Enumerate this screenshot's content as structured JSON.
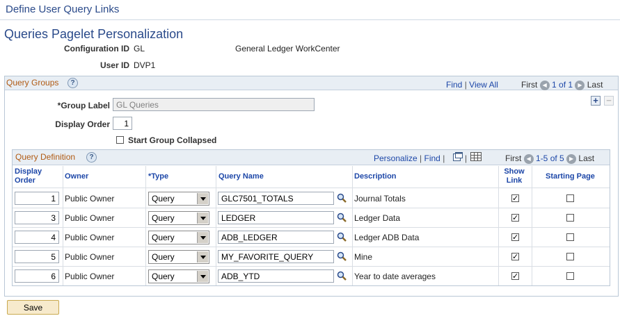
{
  "header": {
    "title": "Define User Query Links"
  },
  "page": {
    "title": "Queries Pagelet Personalization"
  },
  "config": {
    "config_id_label": "Configuration ID",
    "config_id_value": "GL",
    "config_desc": "General Ledger WorkCenter",
    "user_id_label": "User ID",
    "user_id_value": "DVP1"
  },
  "query_groups": {
    "title": "Query Groups",
    "find": "Find",
    "view_all": "View All",
    "first": "First",
    "pager": "1 of 1",
    "last": "Last",
    "group_label_label": "*Group Label",
    "group_label_value": "GL Queries",
    "display_order_label": "Display Order",
    "display_order_value": "1",
    "start_collapsed_label": "Start Group Collapsed",
    "start_collapsed_checked": false
  },
  "query_definition": {
    "title": "Query Definition",
    "personalize": "Personalize",
    "find": "Find",
    "first": "First",
    "pager": "1-5 of 5",
    "last": "Last",
    "columns": {
      "display_order_1": "Display",
      "display_order_2": "Order",
      "owner": "Owner",
      "type": "*Type",
      "query_name": "Query Name",
      "description": "Description",
      "show_link_1": "Show",
      "show_link_2": "Link",
      "starting_page": "Starting Page"
    },
    "rows": [
      {
        "order": "1",
        "owner": "Public Owner",
        "type": "Query",
        "query_name": "GLC7501_TOTALS",
        "description": "Journal Totals",
        "show_link": true,
        "starting_page": false
      },
      {
        "order": "3",
        "owner": "Public Owner",
        "type": "Query",
        "query_name": "LEDGER",
        "description": "Ledger Data",
        "show_link": true,
        "starting_page": false
      },
      {
        "order": "4",
        "owner": "Public Owner",
        "type": "Query",
        "query_name": "ADB_LEDGER",
        "description": "Ledger ADB Data",
        "show_link": true,
        "starting_page": false
      },
      {
        "order": "5",
        "owner": "Public Owner",
        "type": "Query",
        "query_name": "MY_FAVORITE_QUERY",
        "description": "Mine",
        "show_link": true,
        "starting_page": false
      },
      {
        "order": "6",
        "owner": "Public Owner",
        "type": "Query",
        "query_name": "ADB_YTD",
        "description": "Year to date averages",
        "show_link": true,
        "starting_page": false
      }
    ]
  },
  "save_label": "Save",
  "colors": {
    "title_blue": "#2a4a8a",
    "group_orange": "#b05a13",
    "link_blue": "#1d47a8",
    "save_bg": "#f7eacc"
  },
  "icons": {
    "lookup": "magnifier-icon",
    "help": "help-icon",
    "add": "plus-icon",
    "delete": "minus-icon"
  }
}
